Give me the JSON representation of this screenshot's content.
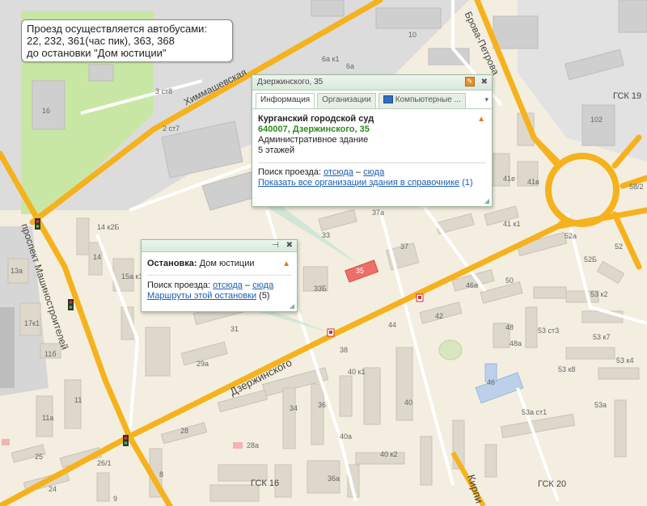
{
  "note": {
    "line1": "Проезд осуществляется автобусами:",
    "line2": "22, 232, 361(час пик), 363, 368",
    "line3": "до остановки \"Дом юстиции\""
  },
  "building_popup": {
    "header": "Дзержинского, 35",
    "tabs": [
      "Информация",
      "Организации",
      "Компьютерные ..."
    ],
    "name": "Курганский городской суд",
    "address": "640007, Дзержинского, 35",
    "type": "Административное здание",
    "floors": "5 этажей",
    "route_label": "Поиск проезда:",
    "from_here": "отсюда",
    "dash": "–",
    "to_here": "сюда",
    "show_all": "Показать все организации здания в справочнике",
    "show_all_count": "(1)"
  },
  "stop_popup": {
    "label": "Остановка:",
    "name": "Дом юстиции",
    "route_label": "Поиск проезда:",
    "from_here": "отсюда",
    "dash": "–",
    "to_here": "сюда",
    "routes_link": "Маршруты этой остановки",
    "routes_count": "(5)"
  },
  "streets": {
    "himmash": "Химмашевская",
    "dzerzh": "Дзержинского",
    "mashin": "проспект Машиностроителей",
    "brova": "Брова-Петрова",
    "kirp": "Кирпи"
  },
  "labels": {
    "b10": "10",
    "b6ak1": "6а к1",
    "b6a": "6а",
    "b16": "16",
    "b3st8": "3 ст8",
    "b2st7": "2 ст7",
    "b102": "102",
    "gsk19": "ГСК 19",
    "b14k2b": "14 к2Б",
    "b14": "14",
    "b13a": "13а",
    "b17k1": "17к1",
    "b11b": "11б",
    "b15ak1": "15а к1",
    "b37a": "37а",
    "b33": "33",
    "b37": "37",
    "b33b": "33Б",
    "b35": "35",
    "b31": "31",
    "b29a": "29а",
    "b38": "38",
    "b44": "44",
    "b42": "42",
    "b46a": "46а",
    "b50": "50",
    "b52a": "52а",
    "b52b": "52Б",
    "b53k2": "53 к2",
    "b53k7": "53 к7",
    "b53st3": "53 ст3",
    "b40k1": "40 к1",
    "b40": "40",
    "b36": "36",
    "b34": "34",
    "b46": "46",
    "b53k8": "53 к8",
    "b53k4": "53 к4",
    "b53a": "53а",
    "b53st1": "53а ст1",
    "b28": "28",
    "b28a": "28а",
    "b11a": "11а",
    "b11": "11",
    "b25": "25",
    "b26_1": "26/1",
    "b24": "24",
    "b9": "9",
    "b8": "8",
    "b40a": "40а",
    "b40k2": "40 к2",
    "gsk16": "ГСК 16",
    "b36a": "36а",
    "gsk20": "ГСК 20",
    "b41k1": "41 к1",
    "b41e": "41е",
    "b41b": "41в",
    "b58_2": "58/2",
    "b48": "48",
    "b48a": "48а",
    "b52": "52"
  },
  "colors": {
    "background": "#f3eedf",
    "road_major": "#f5b21d",
    "park": "#c9e7a4",
    "building": "#d9d4c6",
    "highlight": "#ee6f6a",
    "link": "#1a5db3"
  }
}
